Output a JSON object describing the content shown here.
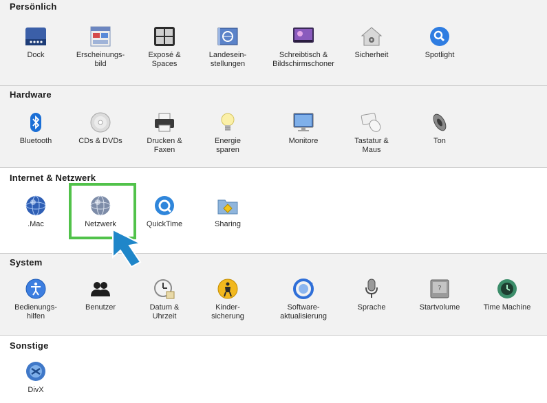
{
  "sections": [
    {
      "title": "Persönlich",
      "items": [
        {
          "label": "Dock",
          "icon": "dock-icon"
        },
        {
          "label": "Erscheinungs-\nbild",
          "icon": "appearance-icon"
        },
        {
          "label": "Exposé &\nSpaces",
          "icon": "expose-spaces-icon"
        },
        {
          "label": "Landesein-\nstellungen",
          "icon": "international-icon"
        },
        {
          "label": "Schreibtisch &\nBildschirmschoner",
          "icon": "desktop-screensaver-icon"
        },
        {
          "label": "Sicherheit",
          "icon": "security-house-icon"
        },
        {
          "label": "Spotlight",
          "icon": "spotlight-icon"
        }
      ]
    },
    {
      "title": "Hardware",
      "items": [
        {
          "label": "Bluetooth",
          "icon": "bluetooth-icon"
        },
        {
          "label": "CDs & DVDs",
          "icon": "cd-dvd-icon"
        },
        {
          "label": "Drucken &\nFaxen",
          "icon": "printer-icon"
        },
        {
          "label": "Energie\nsparen",
          "icon": "lightbulb-icon"
        },
        {
          "label": "Monitore",
          "icon": "monitor-icon"
        },
        {
          "label": "Tastatur &\nMaus",
          "icon": "keyboard-mouse-icon"
        },
        {
          "label": "Ton",
          "icon": "speaker-icon"
        }
      ]
    },
    {
      "title": "Internet & Netzwerk",
      "items": [
        {
          "label": ".Mac",
          "icon": "dotmac-globe-icon"
        },
        {
          "label": "Netzwerk",
          "icon": "network-globe-icon"
        },
        {
          "label": "QuickTime",
          "icon": "quicktime-icon"
        },
        {
          "label": "Sharing",
          "icon": "sharing-folder-icon"
        }
      ]
    },
    {
      "title": "System",
      "items": [
        {
          "label": "Bedienungs-\nhilfen",
          "icon": "accessibility-icon"
        },
        {
          "label": "Benutzer",
          "icon": "users-icon"
        },
        {
          "label": "Datum &\nUhrzeit",
          "icon": "clock-icon"
        },
        {
          "label": "Kinder-\nsicherung",
          "icon": "parental-controls-icon"
        },
        {
          "label": "Software-\naktualisierung",
          "icon": "software-update-icon"
        },
        {
          "label": "Sprache",
          "icon": "microphone-icon"
        },
        {
          "label": "Startvolume",
          "icon": "startup-disk-icon"
        },
        {
          "label": "Time Machine",
          "icon": "time-machine-icon"
        }
      ]
    },
    {
      "title": "Sonstige",
      "items": [
        {
          "label": "DivX",
          "icon": "divx-icon"
        }
      ]
    }
  ],
  "colors": {
    "highlight": "#51c24a",
    "arrow": "#1f86c9",
    "section_bg": "#f2f2f2"
  }
}
